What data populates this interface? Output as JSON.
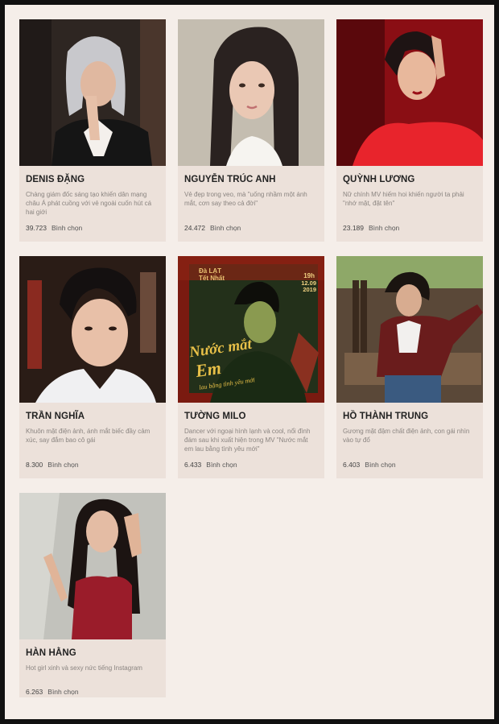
{
  "vote_label": "Bình chọn",
  "cards": [
    {
      "name": "DENIS ĐẶNG",
      "desc": "Chàng giám đốc sáng tạo khiến dân mạng châu Á phát cuồng với vẻ ngoài cuốn hút cá hai giới",
      "votes": "39.723"
    },
    {
      "name": "NGUYỄN TRÚC ANH",
      "desc": "Vẻ đẹp trong veo, mà \"uống nhầm một ánh mắt, cơn say theo cả đời\"",
      "votes": "24.472"
    },
    {
      "name": "QUỲNH LƯƠNG",
      "desc": "Nữ chính MV hiếm hoi khiến người ta phải \"nhớ mặt, đặt tên\"",
      "votes": "23.189"
    },
    {
      "name": "TRẦN NGHĨA",
      "desc": "Khuôn mặt điện ảnh, ánh mắt biếc đầy cảm xúc, say đắm bao cô gái",
      "votes": "8.300"
    },
    {
      "name": "TƯỜNG MILO",
      "desc": "Dancer với ngoại hình lạnh và cool, nổi đình đám sau khi xuất hiện trong MV \"Nước mắt em lau bằng tình yêu mới\"",
      "votes": "6.433"
    },
    {
      "name": "HỒ THÀNH TRUNG",
      "desc": "Gương mặt đậm chất điện ảnh, con gái nhìn vào tự đổ",
      "votes": "6.403"
    },
    {
      "name": "HÀN HẰNG",
      "desc": "Hot girl xinh và sexy nức tiếng Instagram",
      "votes": "6.263"
    }
  ],
  "poster": {
    "tag": "Đà LẠT Tết Nhất",
    "date_time": "19h",
    "date": "12.09 2019",
    "title_1": "Nước mắt",
    "title_2": "Em",
    "title_3": "lau bằng tình yêu mới"
  }
}
